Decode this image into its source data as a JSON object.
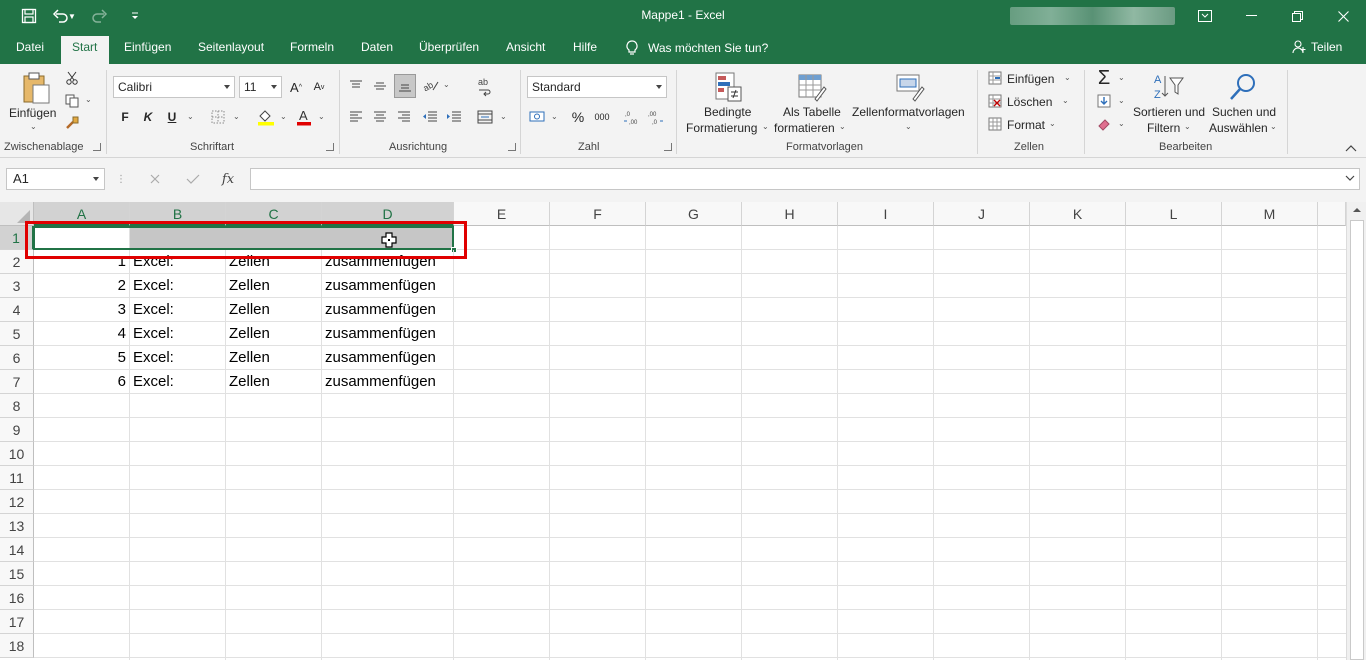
{
  "window": {
    "title": "Mappe1  -  Excel",
    "accent": "#217346"
  },
  "qat": {
    "icons": [
      "save-icon",
      "undo-icon",
      "redo-icon",
      "customize-icon"
    ]
  },
  "tabs": [
    "Datei",
    "Start",
    "Einfügen",
    "Seitenlayout",
    "Formeln",
    "Daten",
    "Überprüfen",
    "Ansicht",
    "Hilfe"
  ],
  "active_tab": "Start",
  "tellme": "Was möchten Sie tun?",
  "share": "Teilen",
  "ribbon": {
    "clipboard": {
      "paste": "Einfügen",
      "label": "Zwischenablage"
    },
    "font": {
      "name": "Calibri",
      "size": "11",
      "bold": "F",
      "italic": "K",
      "underline": "U",
      "label": "Schriftart"
    },
    "alignment": {
      "label": "Ausrichtung"
    },
    "number": {
      "format": "Standard",
      "percent": "%",
      "thousands": "000",
      "label": "Zahl"
    },
    "styles": {
      "conditional_1": "Bedingte",
      "conditional_2": "Formatierung",
      "as_table_1": "Als Tabelle",
      "as_table_2": "formatieren",
      "cell_styles": "Zellenformatvorlagen",
      "label": "Formatvorlagen"
    },
    "cells": {
      "insert": "Einfügen",
      "delete": "Löschen",
      "format": "Format",
      "label": "Zellen"
    },
    "editing": {
      "sort_1": "Sortieren und",
      "sort_2": "Filtern",
      "find_1": "Suchen und",
      "find_2": "Auswählen",
      "label": "Bearbeiten"
    }
  },
  "formula_bar": {
    "name_box": "A1",
    "fx": "fx",
    "value": ""
  },
  "sheet": {
    "columns": [
      "A",
      "B",
      "C",
      "D",
      "E",
      "F",
      "G",
      "H",
      "I",
      "J",
      "K",
      "L",
      "M"
    ],
    "rows": [
      "1",
      "2",
      "3",
      "4",
      "5",
      "6",
      "7",
      "8",
      "9",
      "10",
      "11",
      "12",
      "13",
      "14",
      "15",
      "16",
      "17",
      "18"
    ],
    "data": [
      [
        "1",
        "Excel:",
        "Zellen",
        "zusammenfügen"
      ],
      [
        "2",
        "Excel:",
        "Zellen",
        "zusammenfügen"
      ],
      [
        "3",
        "Excel:",
        "Zellen",
        "zusammenfügen"
      ],
      [
        "4",
        "Excel:",
        "Zellen",
        "zusammenfügen"
      ],
      [
        "5",
        "Excel:",
        "Zellen",
        "zusammenfügen"
      ],
      [
        "6",
        "Excel:",
        "Zellen",
        "zusammenfügen"
      ]
    ],
    "selected_range": "A1:D1",
    "highlight_color": "#e00000"
  }
}
